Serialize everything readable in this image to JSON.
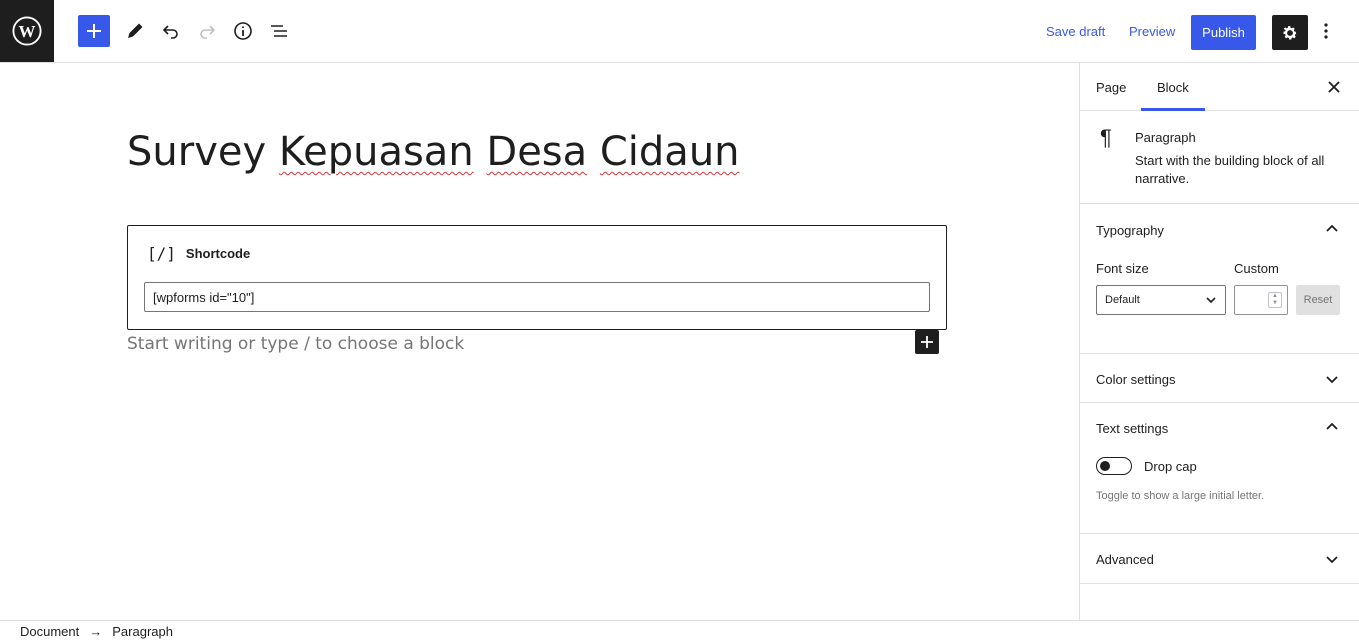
{
  "topbar": {
    "logo_icon": "wordpress-logo",
    "add_icon": "plus-icon",
    "tool_icons": [
      "pencil-icon",
      "undo-icon",
      "redo-icon",
      "info-icon",
      "list-view-icon"
    ],
    "save_draft": "Save draft",
    "preview": "Preview",
    "publish": "Publish",
    "settings_icon": "gear-icon",
    "options_icon": "more-vertical-icon",
    "accent_color": "#3858e9"
  },
  "editor": {
    "title_words": [
      "Survey",
      "Kepuasan",
      "Desa",
      "Cidaun"
    ],
    "shortcode_block": {
      "icon_text": "[/]",
      "label": "Shortcode",
      "value": "[wpforms id=\"10\"]"
    },
    "placeholder": "Start writing or type / to choose a block"
  },
  "sidebar": {
    "tabs": [
      {
        "label": "Page",
        "active": false
      },
      {
        "label": "Block",
        "active": true
      }
    ],
    "block_card": {
      "icon": "¶",
      "title": "Paragraph",
      "description": "Start with the building block of all narrative."
    },
    "typography": {
      "title": "Typography",
      "font_size_label": "Font size",
      "custom_label": "Custom",
      "font_size_value": "Default",
      "reset_label": "Reset"
    },
    "color_settings": {
      "title": "Color settings"
    },
    "text_settings": {
      "title": "Text settings",
      "drop_cap_label": "Drop cap",
      "drop_cap_on": false,
      "help": "Toggle to show a large initial letter."
    },
    "advanced": {
      "title": "Advanced"
    }
  },
  "footer": {
    "crumbs": [
      "Document",
      "Paragraph"
    ],
    "separator": "→"
  }
}
